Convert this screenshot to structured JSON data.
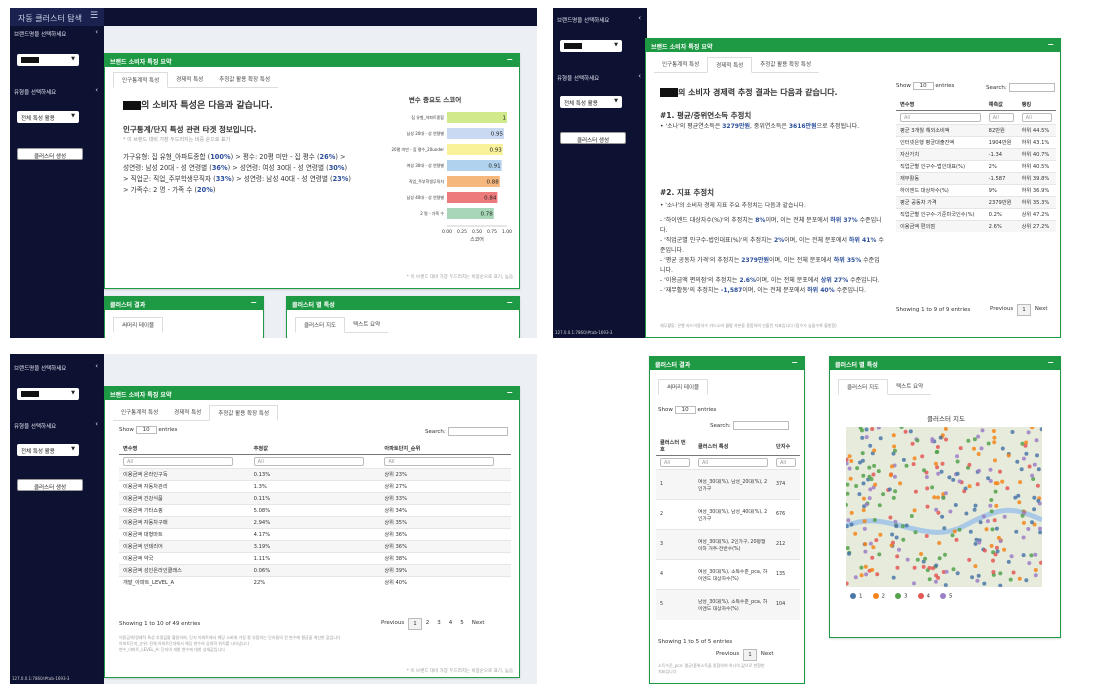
{
  "app": {
    "title": "자동 클러스터 탐색",
    "menu_icon": "hamburger-icon"
  },
  "sidebar": {
    "brand_label": "브랜드명을 선택하세요",
    "type_label": "유형을 선택하세요",
    "type_value": "전체 특성 활용",
    "cluster_button": "클러스터 생성"
  },
  "summary_box": {
    "title": "브랜드 소비자 특징 요약",
    "tabs": [
      "인구통계적 특성",
      "경제적 특성",
      "추정값 활용 확장 특성"
    ],
    "minimize": "−"
  },
  "q1": {
    "heading": "의 소비자 특성은 다음과 같습니다.",
    "subheading": "인구통계/단지 특성 관련 타겟 정보입니다.",
    "note": "* 이 브랜드 대비 가장 두드러지는 비중 순으로 표기",
    "desc_a": "가구유형: 집 유형_아파트종합 (",
    "desc_a_v": "100%",
    "desc_b": ") > 평수: 20평 미만 - 집 평수 (",
    "desc_b_v": "26%",
    "desc_c": ") > 성연령: 남성 20대 - 성 연령별 (",
    "desc_c_v": "36%",
    "desc_d": ") > 성연령: 여성 30대 - 성 연령별 (",
    "desc_d_v": "30%",
    "desc_e": ") > 직업군: 직업_주부학생무직자 (",
    "desc_e_v": "33%",
    "desc_f": ") > 성연령: 남성 40대 - 성 연령별 (",
    "desc_f_v": "23%",
    "desc_g": ") > 가족수: 2 명 - 가족 수 (",
    "desc_g_v": "20%",
    "desc_end": ")",
    "footnote": "* 이 브랜드 대비 가장 두드러지는 비중순으로 표기, 높음",
    "cluster_result_title": "클러스터 결과",
    "cluster_feature_title": "클러스터 별 특성",
    "result_tab": "써머리 테이블",
    "feature_tabs": [
      "클러스터 지도",
      "텍스트 요약"
    ]
  },
  "chart_data": {
    "type": "bar",
    "title": "변수 중요도 스코어",
    "xlabel": "스코어",
    "categories": [
      "집 유형_아파트종합",
      "남성 20대 - 성 연령별",
      "20평 미만 - 집 평수_20under",
      "여성 30대 - 성 연령별",
      "직업_주부학생무직자",
      "남성 40대 - 성 연령별",
      "2 명 - 가족 수"
    ],
    "values": [
      1.0,
      0.95,
      0.93,
      0.91,
      0.88,
      0.84,
      0.78
    ],
    "value_labels": [
      "1",
      "0.95",
      "0.93",
      "0.91",
      "0.88",
      "0.84",
      "0.78"
    ],
    "colors": [
      "#cfe98b",
      "#c9d9f1",
      "#f9f29b",
      "#b0d2ee",
      "#f5b77c",
      "#ee7b7b",
      "#a7d7b8"
    ],
    "xticks": [
      "0.00",
      "0.25",
      "0.50",
      "0.75",
      "1.00"
    ],
    "xlim": [
      0,
      1.0
    ]
  },
  "q2": {
    "heading": "의 소비자 경제력 추정 결과는 다음과 같습니다.",
    "s1_title": "#1. 평균/중위연소득 추정치",
    "s1_a": "• '소나'의 평균연소득은 ",
    "s1_v1": "3279만원",
    "s1_b": ", 중위연소득은 ",
    "s1_v2": "3616만원",
    "s1_c": "으로 추정됩니다.",
    "s2_title": "#2. 지표 추정치",
    "s2_intro": "• '소나'의 소비자 경제 지표 주요 추정치는 다음과 같습니다.",
    "s2_l1a": "- '하이엔드 대상자수(%)'의 추정치는 ",
    "s2_l1v": "8%",
    "s2_l1b": "이며, 이는 전체 분포에서 ",
    "s2_l1r": "하위 37%",
    "s2_l1c": " 수준입니다.",
    "s2_l2a": "- '직업군별 인구수-법인대표(%)'의 추정치는 ",
    "s2_l2v": "2%",
    "s2_l2b": "이며, 이는 전체 분포에서 ",
    "s2_l2r": "하위 41%",
    "s2_l2c": " 수준입니다.",
    "s2_l3a": "- '평균 공동차 가격'의 추정치는 ",
    "s2_l3v": "2379만원",
    "s2_l3b": "이며, 이는 전체 분포에서 ",
    "s2_l3r": "하위 35%",
    "s2_l3c": " 수준입니다.",
    "s2_l4a": "- '이용금액 편의점'의 추정치는 ",
    "s2_l4v": "2.6%",
    "s2_l4b": "이며, 이는 전체 분포에서 ",
    "s2_l4r": "상위 27%",
    "s2_l4c": " 수준입니다.",
    "s2_l5a": "- '재무활동'의 추정치는 ",
    "s2_l5v": "-1,587",
    "s2_l5b": "이며, 이는 전체 분포에서 ",
    "s2_l5r": "하위 40%",
    "s2_l5c": " 수준입니다.",
    "foot": "재무활동: 은행 카드이용자수 카드소비 월평 자본을 종합하여 산출된 지표입니다 (점수가 높을수록 활발함)",
    "show_label": "Show",
    "show_val": "10",
    "entries": "entries",
    "search_label": "Search:",
    "columns": [
      "변수명",
      "예측값",
      "랭킹"
    ],
    "filter_all": "All",
    "rows": [
      [
        "평균 3개월 해외소비액",
        "82만원",
        "하위 44.5%"
      ],
      [
        "인터넷은행 평균대출잔액",
        "1904만원",
        "하위 43.1%"
      ],
      [
        "자산가치",
        "-1.34",
        "하위 40.7%"
      ],
      [
        "직업군별 인구수-법인대표(%)",
        "2%",
        "하위 40.5%"
      ],
      [
        "재무활동",
        "-1.587",
        "하위 39.8%"
      ],
      [
        "하이엔드 대상자수(%)",
        "9%",
        "하위 36.9%"
      ],
      [
        "평균 공동차 가격",
        "2379만원",
        "하위 35.3%"
      ],
      [
        "직업군별 인구수-기준미국인수(%)",
        "0.2%",
        "상위 47.2%"
      ],
      [
        "이용금액 편의점",
        "2.6%",
        "상위 27.2%"
      ]
    ],
    "info": "Showing 1 to 9 of 9 entries",
    "prev": "Previous",
    "next": "Next",
    "page": "1",
    "url": "127.0.0.1:7860/#tab-1693-3"
  },
  "q3": {
    "show_label": "Show",
    "show_val": "10",
    "entries": "entries",
    "search_label": "Search:",
    "columns": [
      "변수명",
      "추정값",
      "아파트단지_순위"
    ],
    "filter_all": "All",
    "rows": [
      [
        "이용금액 온라인구독",
        "0.13%",
        "상위 23%"
      ],
      [
        "이용금액 자동차관리",
        "1.3%",
        "상위 27%"
      ],
      [
        "이용금액 건강식품",
        "0.11%",
        "상위 33%"
      ],
      [
        "이용금액 기타쇼핑",
        "5.08%",
        "상위 34%"
      ],
      [
        "이용금액 자동차구매",
        "2.94%",
        "상위 35%"
      ],
      [
        "이용금액 대형마트",
        "4.17%",
        "상위 36%"
      ],
      [
        "이용금액 인테리어",
        "3.19%",
        "상위 36%"
      ],
      [
        "이용금액 약국",
        "1.11%",
        "상위 38%"
      ],
      [
        "이용금액 성인온라인클래스",
        "0.06%",
        "상위 39%"
      ],
      [
        "개발_아파트_LEVEL_A",
        "22%",
        "상위 40%"
      ]
    ],
    "info": "Showing 1 to 10 of 49 entries",
    "prev": "Previous",
    "pages": [
      "1",
      "2",
      "3",
      "4",
      "5"
    ],
    "next": "Next",
    "note1": "이용금액/경제적 특성 추정값을 활용하여, 단지 아파트에서 해당 소비에 가장 잘 부합하는 단지들의 전 변수에 평균을 계산한 값입니다",
    "note2": "아파트단지_순위: 전체 아파트단지에서 해당 변수의 상대적 위치를 나타냅니다",
    "note3": "변수_아파트_LEVEL_A: 단지의 개발 변수에 대한 상세값입니다",
    "footnote": "* 이 브랜드 대비 가장 두드러지는 비중순으로 표기, 높음",
    "url": "127.0.0.1:7860/#tab-1693-3"
  },
  "q4": {
    "result_title": "클러스터 결과",
    "feature_title": "클러스터 별 특성",
    "result_tab": "써머리 테이블",
    "feature_tabs": [
      "클러스터 지도",
      "텍스트 요약"
    ],
    "map_title": "클러스터 지도",
    "show_label": "Show",
    "show_val": "10",
    "entries": "entries",
    "search_label": "Search:",
    "columns": [
      "클러스터 번호",
      "클러스터 특성",
      "단지수"
    ],
    "filter_all": "All",
    "rows": [
      [
        "1",
        "여성_30대(%), 남성_20대(%), 2인가구",
        "374"
      ],
      [
        "2",
        "여성_30대(%), 남성_40대(%), 2인가구",
        "676"
      ],
      [
        "3",
        "여성_30대(%), 2인가구, 20평형 이하 거주-전반수(%)",
        "212"
      ],
      [
        "4",
        "여성_30대(%), 소득수준_pca, 하이엔드 대상자수(%)",
        "135"
      ],
      [
        "5",
        "남성_30대(%), 소득수준_pca, 하이엔드 대상자수(%)",
        "104"
      ]
    ],
    "info": "Showing 1 to 5 of 5 entries",
    "prev": "Previous",
    "page": "1",
    "next": "Next",
    "note": "소득수준_pca: 평균/중위소득을 종합하여 하나의 값으로 변환한 지표입니다",
    "legend": [
      {
        "label": "1",
        "color": "#4c78a8"
      },
      {
        "label": "2",
        "color": "#f58518"
      },
      {
        "label": "3",
        "color": "#54a24b"
      },
      {
        "label": "4",
        "color": "#e45756"
      },
      {
        "label": "5",
        "color": "#9d7fc7"
      }
    ]
  }
}
